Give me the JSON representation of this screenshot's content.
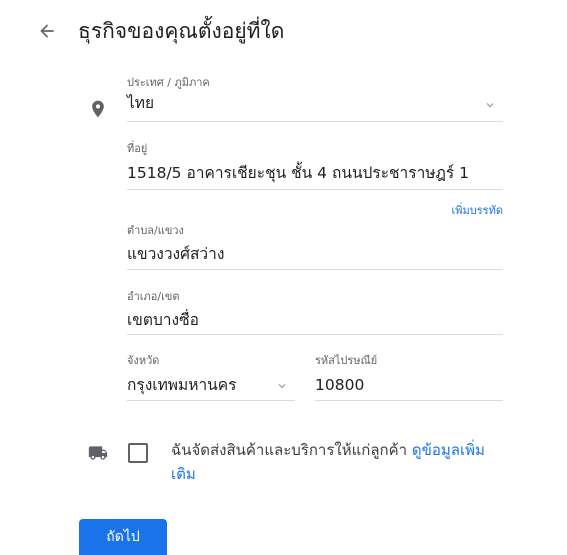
{
  "header": {
    "title": "ธุรกิจของคุณตั้งอยู่ที่ใด"
  },
  "form": {
    "country": {
      "label": "ประเทศ / ภูมิภาค",
      "value": "ไทย"
    },
    "address": {
      "label": "ที่อยู่",
      "value": "1518/5 อาคารเชียะชุน ชั้น 4 ถนนประชาราษฎร์ 1",
      "add_line_link": "เพิ่มบรรทัด"
    },
    "subdistrict": {
      "label": "ตำบล/แขวง",
      "value": "แขวงวงศ์สว่าง"
    },
    "district": {
      "label": "อำเภอ/เขต",
      "value": "เขตบางซื่อ"
    },
    "province": {
      "label": "จังหวัด",
      "value": "กรุงเทพมหานคร"
    },
    "postal": {
      "label": "รหัสไปรษณีย์",
      "value": "10800"
    }
  },
  "delivery": {
    "text": "ฉันจัดส่งสินค้าและบริการให้แก่ลูกค้า",
    "more_link": "ดูข้อมูลเพิ่มเติม",
    "checked": false
  },
  "actions": {
    "next_label": "ถัดไป"
  },
  "colors": {
    "accent": "#1a73e8",
    "icon": "#5f6368",
    "divider": "#dadce0"
  }
}
